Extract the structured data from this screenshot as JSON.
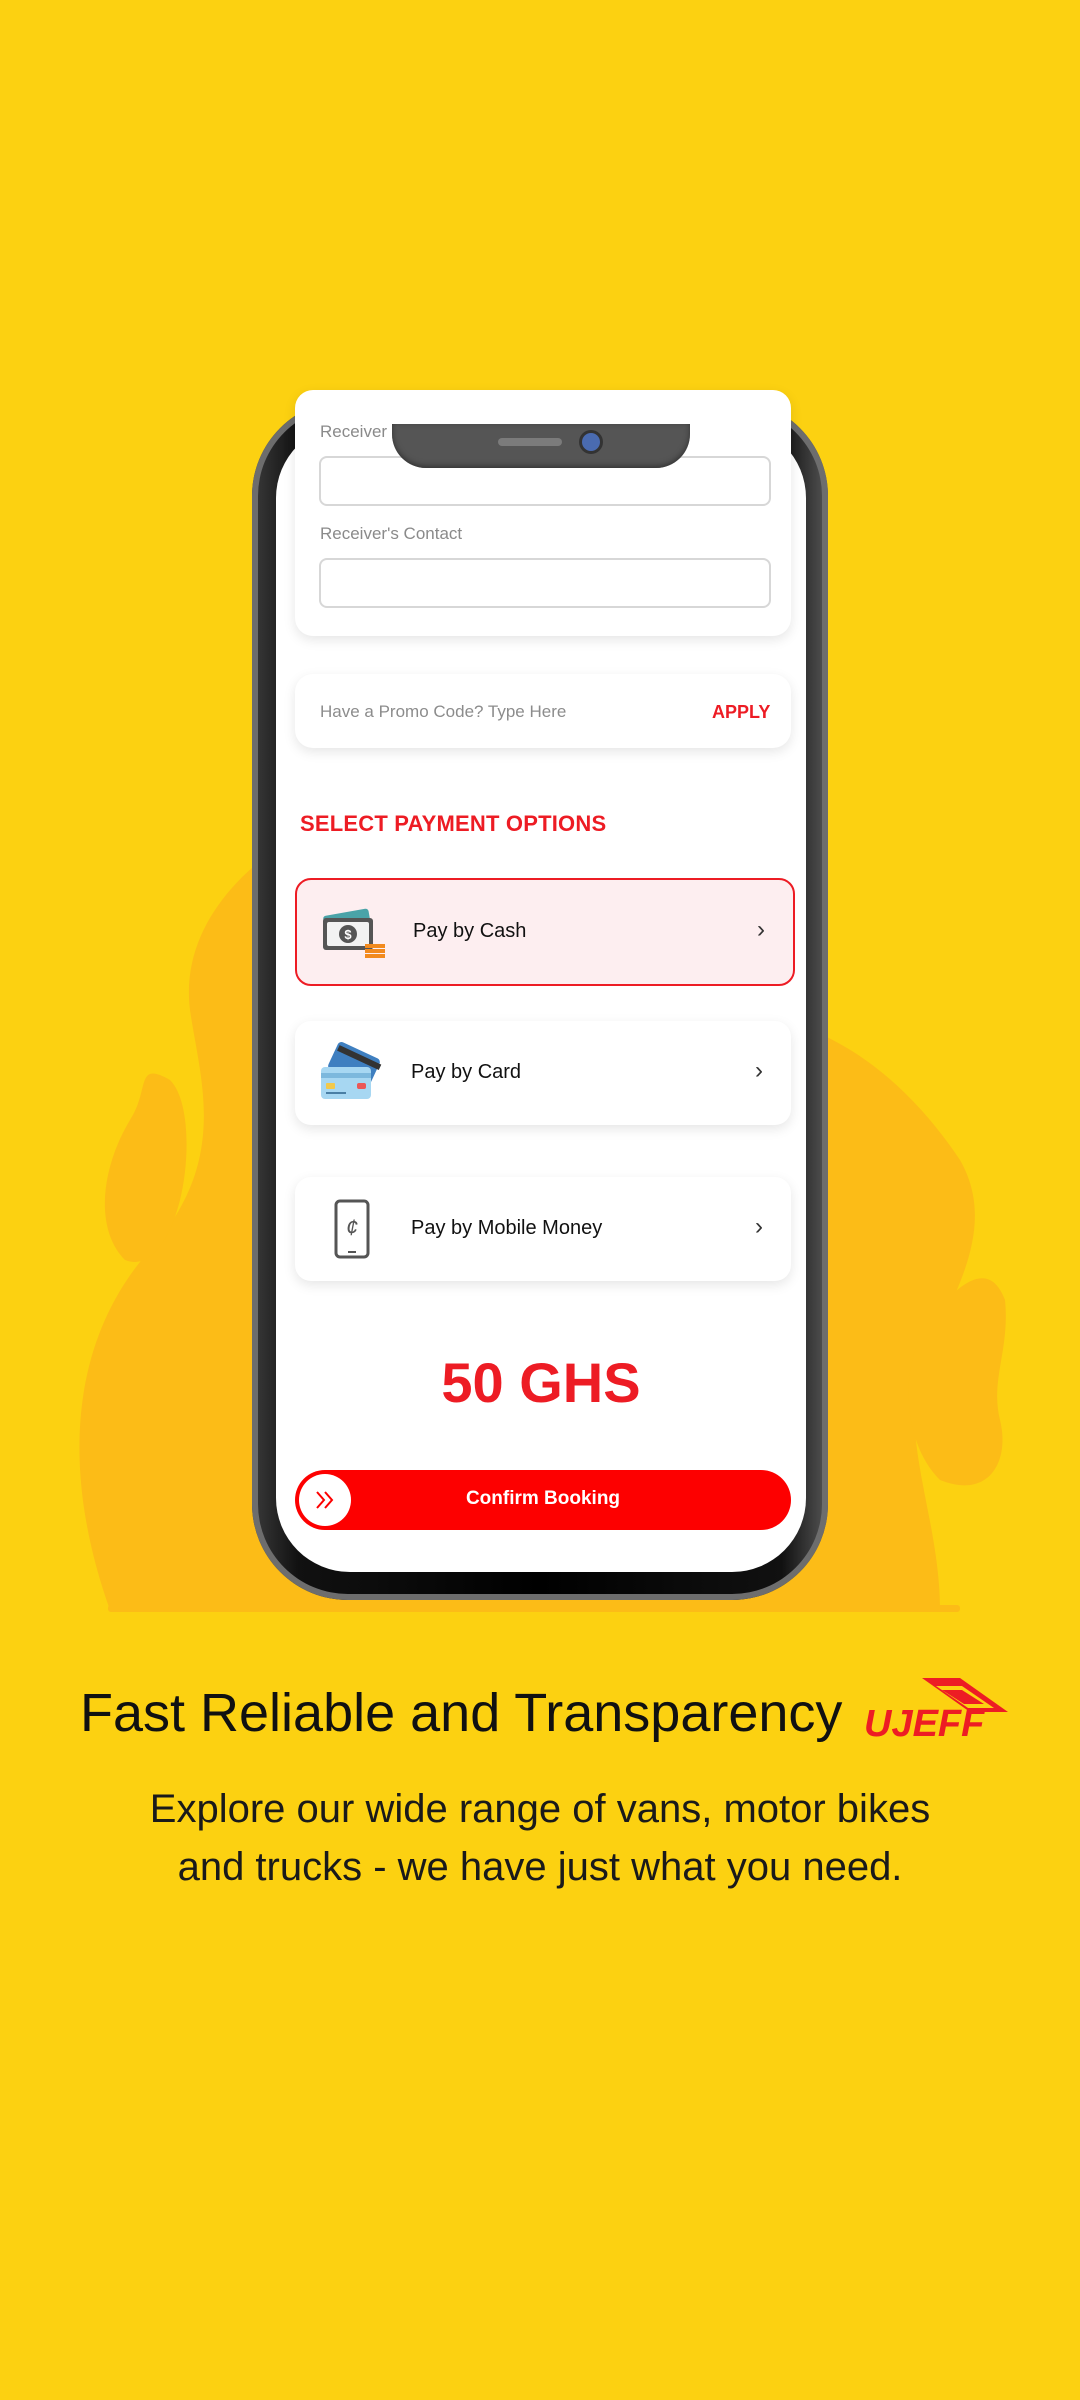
{
  "form": {
    "receiver_name_label": "Receiver",
    "receiver_contact_label": "Receiver's Contact",
    "receiver_name_value": "",
    "receiver_contact_value": ""
  },
  "promo": {
    "placeholder": "Have a Promo Code? Type Here",
    "apply_label": "APPLY"
  },
  "payment": {
    "title": "SELECT PAYMENT OPTIONS",
    "options": [
      {
        "label": "Pay by Cash",
        "icon": "cash-icon",
        "selected": true
      },
      {
        "label": "Pay by Card",
        "icon": "credit-card-icon",
        "selected": false
      },
      {
        "label": "Pay by Mobile Money",
        "icon": "mobile-money-icon",
        "selected": false
      }
    ]
  },
  "price": "50 GHS",
  "confirm_label": "Confirm Booking",
  "headline": "Fast Reliable and Transparency",
  "brand": "UJEFF",
  "subtext": "Explore our wide range of vans, motor bikes and trucks - we have just what you need.",
  "colors": {
    "background": "#FCD111",
    "accent": "#ED1C24",
    "button": "#FD0000"
  }
}
